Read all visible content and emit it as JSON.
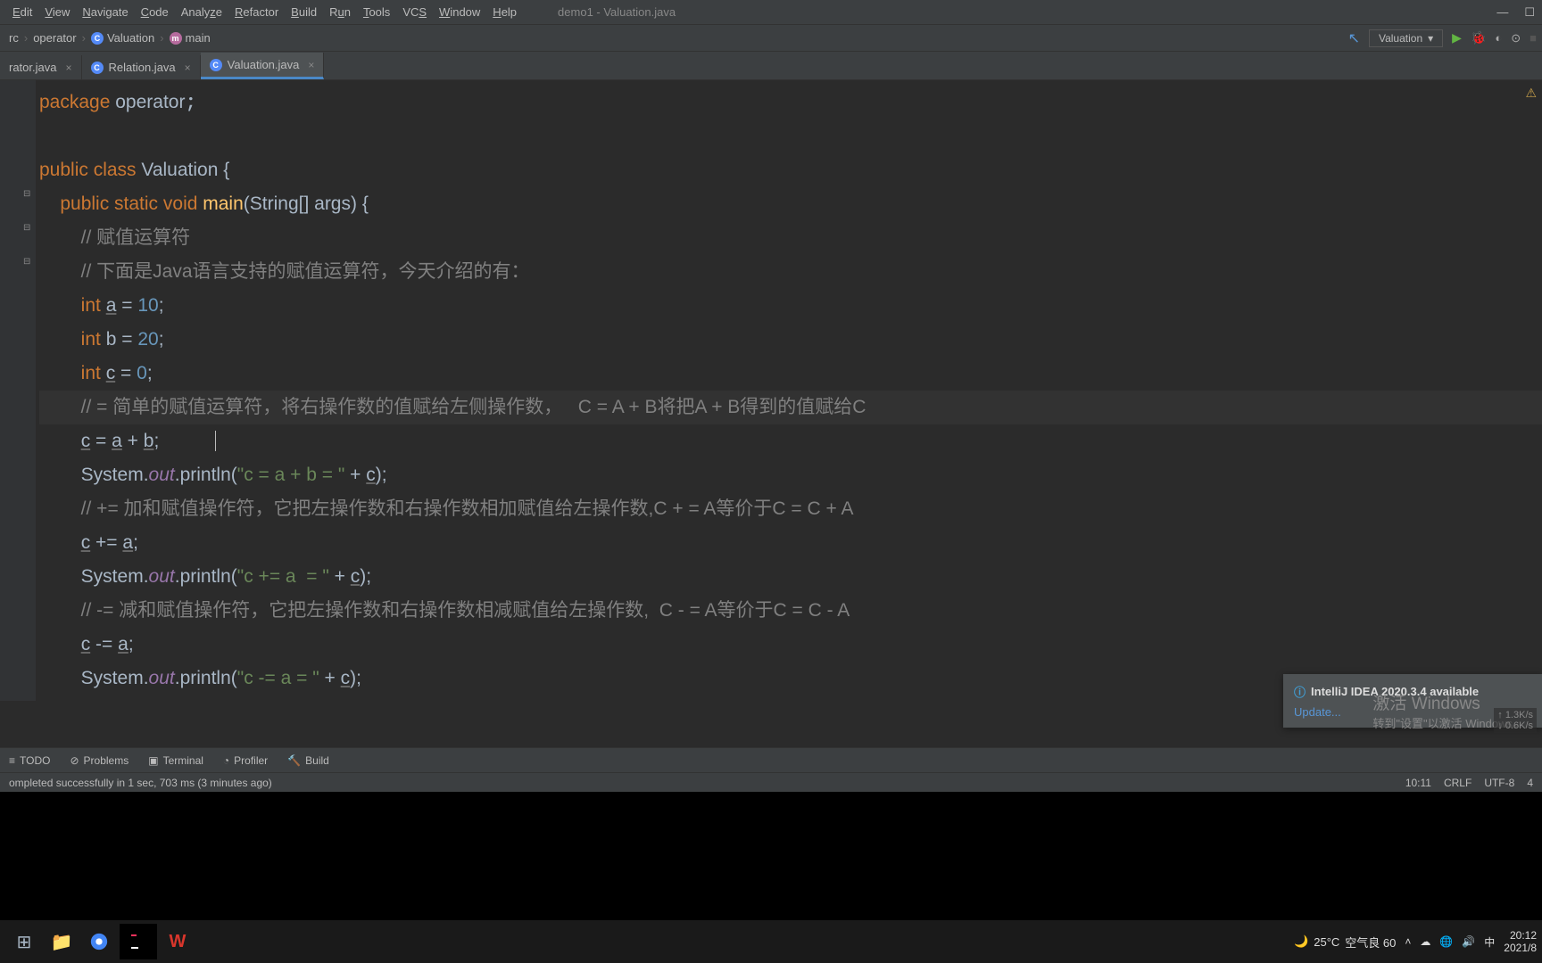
{
  "window": {
    "title": "demo1 - Valuation.java"
  },
  "menu": [
    "Edit",
    "View",
    "Navigate",
    "Code",
    "Analyze",
    "Refactor",
    "Build",
    "Run",
    "Tools",
    "VCS",
    "Window",
    "Help"
  ],
  "breadcrumbs": {
    "src": "rc",
    "pkg": "operator",
    "cls": "Valuation",
    "meth": "main"
  },
  "run_config": {
    "name": "Valuation"
  },
  "tabs": [
    {
      "name": "rator.java",
      "active": false
    },
    {
      "name": "Relation.java",
      "active": false
    },
    {
      "name": "Valuation.java",
      "active": true
    }
  ],
  "code": {
    "l1a": "package ",
    "l1b": "operator",
    "l3a": "public class ",
    "l3b": "Valuation ",
    "l3c": "{",
    "l4a": "    public static void ",
    "l4b": "main",
    "l4c": "(String[] args) {",
    "l5": "        // 赋值运算符",
    "l6": "        // 下面是Java语言支持的赋值运算符，今天介绍的有：",
    "l7a": "        int ",
    "l7b": "a",
    "l7c": " = ",
    "l7d": "10",
    "l7e": ";",
    "l8a": "        int ",
    "l8b": "b = ",
    "l8c": "20",
    "l8d": ";",
    "l9a": "        int ",
    "l9b": "c",
    "l9c": " = ",
    "l9d": "0",
    "l9e": ";",
    "l10": "        // = 简单的赋值运算符，将右操作数的值赋给左侧操作数，   C = A + B将把A + B得到的值赋给C",
    "l11a": "        ",
    "l11b": "c",
    "l11c": " = ",
    "l11d": "a",
    "l11e": " + ",
    "l11f": "b",
    "l11g": ";",
    "l12a": "        System.",
    "l12b": "out",
    "l12c": ".println(",
    "l12d": "\"c = a + b = \"",
    "l12e": " + ",
    "l12f": "c",
    "l12g": ");",
    "l13": "        // += 加和赋值操作符，它把左操作数和右操作数相加赋值给左操作数,C + = A等价于C = C + A",
    "l14a": "        ",
    "l14b": "c",
    "l14c": " += ",
    "l14d": "a",
    "l14e": ";",
    "l15a": "        System.",
    "l15b": "out",
    "l15c": ".println(",
    "l15d": "\"c += a  = \"",
    "l15e": " + ",
    "l15f": "c",
    "l15g": ");",
    "l16": "        // -= 减和赋值操作符，它把左操作数和右操作数相减赋值给左操作数,  C - = A等价于C = C - A",
    "l17a": "        ",
    "l17b": "c",
    "l17c": " -= ",
    "l17d": "a",
    "l17e": ";",
    "l18a": "        System.",
    "l18b": "out",
    "l18c": ".println(",
    "l18d": "\"c -= a = \"",
    "l18e": " + ",
    "l18f": "c",
    "l18g": ");"
  },
  "notification": {
    "title": "IntelliJ IDEA 2020.3.4 available",
    "link": "Update..."
  },
  "watermark": {
    "title": "激活 Windows",
    "sub": "转到\"设置\"以激活 Windows。"
  },
  "netspeed": {
    "up": "1.3K/s",
    "down": "0.6K/s"
  },
  "bottom_tools": {
    "todo": "TODO",
    "problems": "Problems",
    "terminal": "Terminal",
    "profiler": "Profiler",
    "build": "Build"
  },
  "status": {
    "left": "ompleted successfully in 1 sec, 703 ms (3 minutes ago)",
    "pos": "10:11",
    "crlf": "CRLF",
    "enc": "UTF-8",
    "spaces": "4"
  },
  "weather": {
    "temp": "25°C",
    "text": "空气良 60"
  },
  "tray": {
    "ime": "中",
    "time": "20:12",
    "date": "2021/8"
  }
}
